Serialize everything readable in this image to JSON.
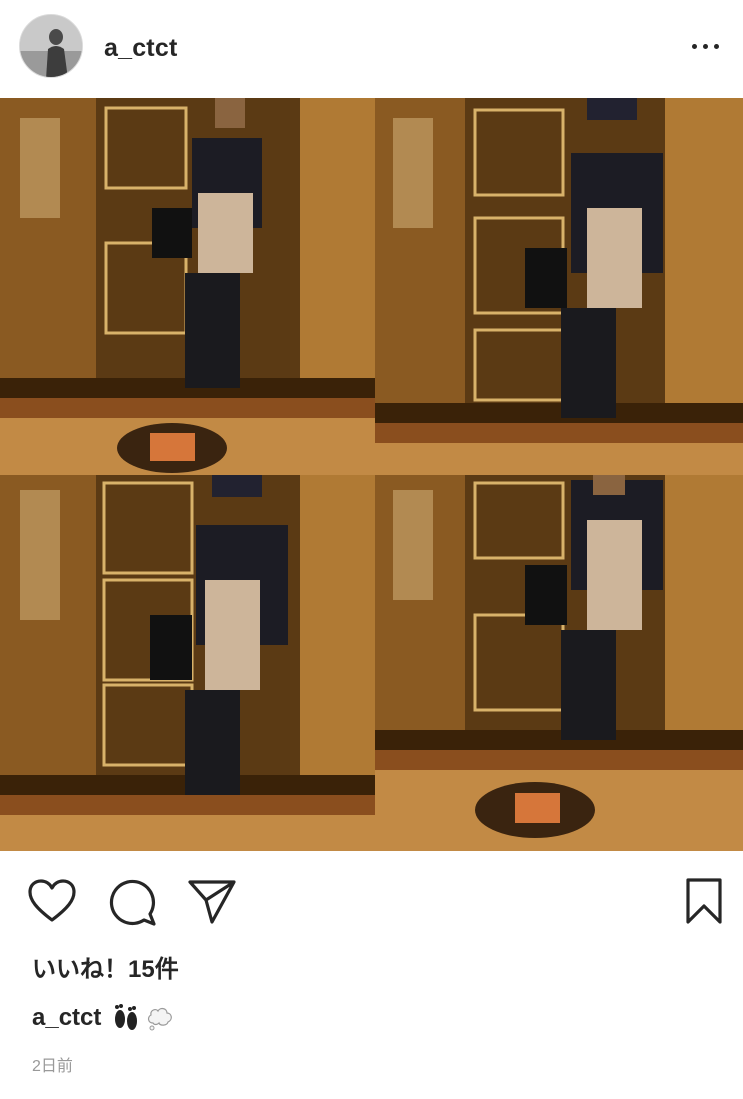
{
  "post": {
    "username": "a_ctct",
    "likes_label": "いいね！15件",
    "caption_user": "a_ctct",
    "caption_emojis": [
      "footprints-icon",
      "thought-balloon-icon"
    ],
    "timestamp": "2日前"
  },
  "icons": {
    "more": "more-options-icon",
    "like": "heart-icon",
    "comment": "comment-icon",
    "share": "paper-plane-icon",
    "save": "bookmark-icon"
  },
  "colors": {
    "text": "#262626",
    "muted": "#999999",
    "background": "#ffffff"
  }
}
